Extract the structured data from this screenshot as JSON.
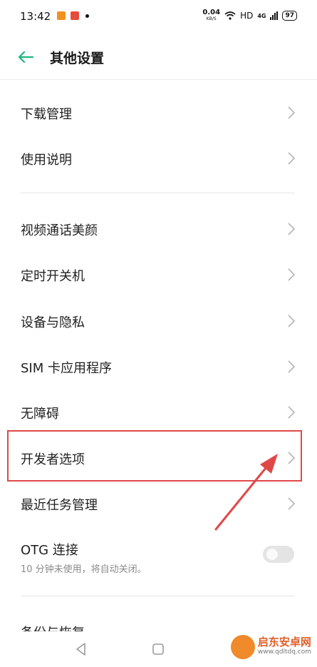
{
  "status": {
    "time": "13:42",
    "net_speed": "0.04",
    "net_unit": "KB/S",
    "hd": "HD",
    "network": "4G",
    "battery": "97"
  },
  "header": {
    "title": "其他设置"
  },
  "group1": [
    {
      "label": "下载管理"
    },
    {
      "label": "使用说明"
    }
  ],
  "group2": [
    {
      "label": "视频通话美颜"
    },
    {
      "label": "定时开关机"
    },
    {
      "label": "设备与隐私"
    },
    {
      "label": "SIM 卡应用程序"
    },
    {
      "label": "无障碍"
    },
    {
      "label": "开发者选项"
    },
    {
      "label": "最近任务管理"
    }
  ],
  "otg": {
    "label": "OTG 连接",
    "desc": "10 分钟未使用，将自动关闭。",
    "enabled": false
  },
  "partial": {
    "label": "备份与恢复"
  },
  "watermark": {
    "title": "启东安卓网",
    "url": "www.qdltdq.com"
  },
  "colors": {
    "accent": "#1fb57f",
    "annotation": "#e04848"
  }
}
